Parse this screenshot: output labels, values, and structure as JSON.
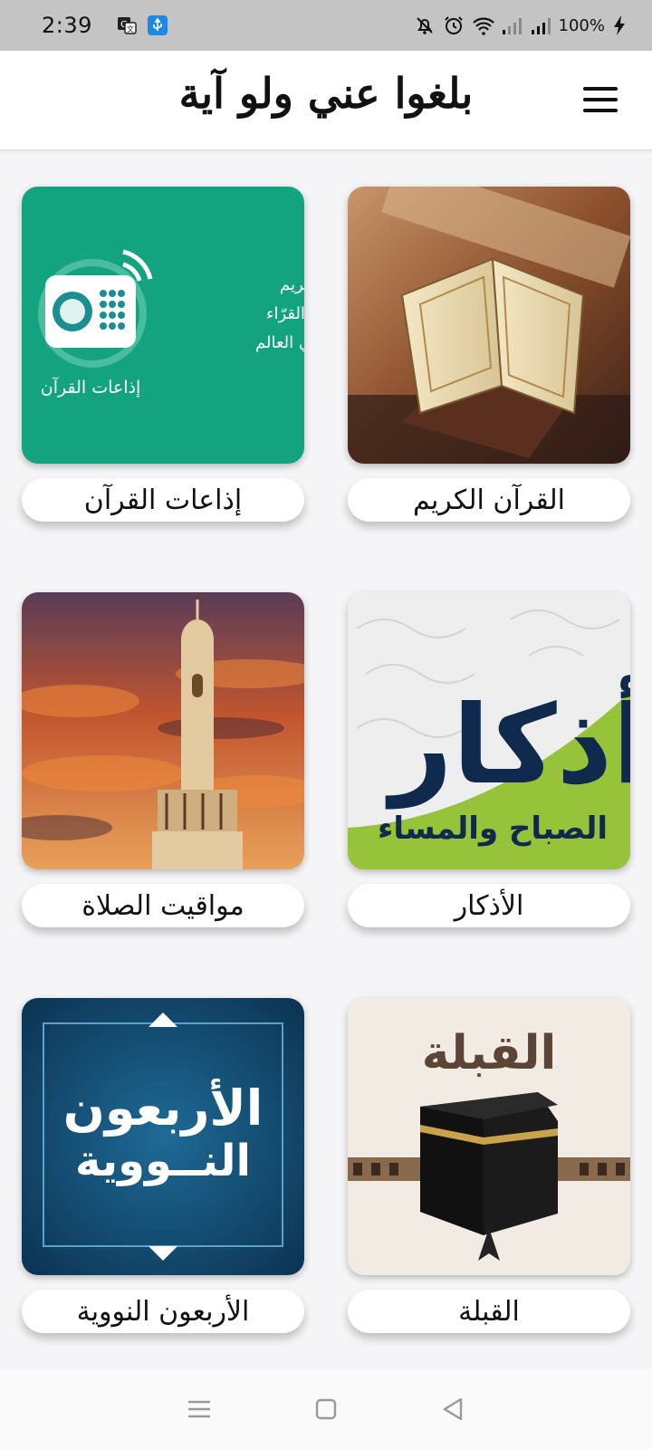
{
  "status_bar": {
    "time": "2:39",
    "battery": "100%",
    "left_icons": [
      "translate-icon",
      "usb-icon"
    ],
    "right_icons": [
      "bell-off-icon",
      "alarm-icon",
      "wifi-icon",
      "signal-icon",
      "signal-icon",
      "charging-icon"
    ]
  },
  "app_bar": {
    "title": "بلغوا عني ولو آية",
    "menu_icon": "hamburger-menu-icon"
  },
  "tiles": [
    {
      "label": "القرآن الكريم",
      "image": "open-quran-on-stand"
    },
    {
      "label": "إذاعات القرآن",
      "image": "quran-radio-banner",
      "image_text": [
        "اذاعات القرآن الكريم",
        "لمشاهير القرّاء",
        "في العالم"
      ],
      "image_caption": "إذاعات القرآن"
    },
    {
      "label": "الأذكار",
      "image": "adhkar-calligraphy",
      "image_text": [
        "أذكار",
        "الصباح والمساء"
      ]
    },
    {
      "label": "مواقيت الصلاة",
      "image": "minaret-sunset"
    },
    {
      "label": "القبلة",
      "image": "kaaba-qibla",
      "image_text": [
        "القبلة"
      ]
    },
    {
      "label": "الأربعون النووية",
      "image": "forty-hadith-banner",
      "image_text": [
        "الأربعون",
        "النــووية"
      ]
    }
  ],
  "colors": {
    "status_bar": "#c4c4c4",
    "radio_green": "#14a37f",
    "adhkar_green": "#97c33a",
    "adhkar_navy": "#0f2a4d",
    "nawawi_blue": "#155079"
  },
  "nav_bar": {
    "items": [
      "recent-apps-icon",
      "home-icon",
      "back-icon"
    ]
  }
}
